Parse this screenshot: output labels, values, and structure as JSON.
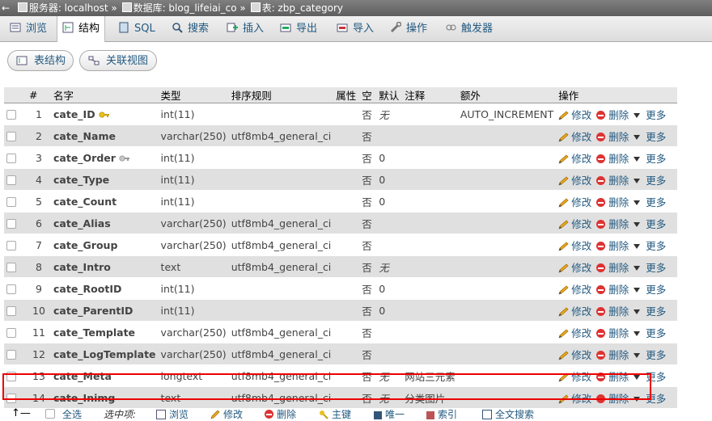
{
  "breadcrumb": {
    "server_label": "服务器: localhost",
    "db_label": "数据库: blog_lifeiai_co",
    "table_label": "表: zbp_category"
  },
  "tabs": [
    {
      "label": "浏览",
      "icon": "browse-icon"
    },
    {
      "label": "结构",
      "icon": "structure-icon",
      "active": true
    },
    {
      "label": "SQL",
      "icon": "sql-icon"
    },
    {
      "label": "搜索",
      "icon": "search-icon"
    },
    {
      "label": "插入",
      "icon": "insert-icon"
    },
    {
      "label": "导出",
      "icon": "export-icon"
    },
    {
      "label": "导入",
      "icon": "import-icon"
    },
    {
      "label": "操作",
      "icon": "wrench-icon"
    },
    {
      "label": "触发器",
      "icon": "trigger-icon"
    }
  ],
  "subtabs": {
    "table_structure": "表结构",
    "relation_view": "关联视图"
  },
  "columns": [
    "#",
    "名字",
    "类型",
    "排序规则",
    "属性",
    "空",
    "默认",
    "注释",
    "额外",
    "操作"
  ],
  "actions": {
    "edit": "修改",
    "drop": "删除",
    "more": "更多"
  },
  "rows": [
    {
      "num": "1",
      "name": "cate_ID",
      "key": "primary",
      "type": "int(11)",
      "collation": "",
      "null": "否",
      "default": "无",
      "comment": "",
      "extra": "AUTO_INCREMENT"
    },
    {
      "num": "2",
      "name": "cate_Name",
      "type": "varchar(250)",
      "collation": "utf8mb4_general_ci",
      "null": "否",
      "default": "",
      "comment": "",
      "extra": ""
    },
    {
      "num": "3",
      "name": "cate_Order",
      "key": "index",
      "type": "int(11)",
      "collation": "",
      "null": "否",
      "default": "0",
      "comment": "",
      "extra": ""
    },
    {
      "num": "4",
      "name": "cate_Type",
      "type": "int(11)",
      "collation": "",
      "null": "否",
      "default": "0",
      "comment": "",
      "extra": ""
    },
    {
      "num": "5",
      "name": "cate_Count",
      "type": "int(11)",
      "collation": "",
      "null": "否",
      "default": "0",
      "comment": "",
      "extra": ""
    },
    {
      "num": "6",
      "name": "cate_Alias",
      "type": "varchar(250)",
      "collation": "utf8mb4_general_ci",
      "null": "否",
      "default": "",
      "comment": "",
      "extra": ""
    },
    {
      "num": "7",
      "name": "cate_Group",
      "type": "varchar(250)",
      "collation": "utf8mb4_general_ci",
      "null": "否",
      "default": "",
      "comment": "",
      "extra": ""
    },
    {
      "num": "8",
      "name": "cate_Intro",
      "type": "text",
      "collation": "utf8mb4_general_ci",
      "null": "否",
      "default": "无",
      "comment": "",
      "extra": ""
    },
    {
      "num": "9",
      "name": "cate_RootID",
      "type": "int(11)",
      "collation": "",
      "null": "否",
      "default": "0",
      "comment": "",
      "extra": ""
    },
    {
      "num": "10",
      "name": "cate_ParentID",
      "type": "int(11)",
      "collation": "",
      "null": "否",
      "default": "0",
      "comment": "",
      "extra": ""
    },
    {
      "num": "11",
      "name": "cate_Template",
      "type": "varchar(250)",
      "collation": "utf8mb4_general_ci",
      "null": "否",
      "default": "",
      "comment": "",
      "extra": ""
    },
    {
      "num": "12",
      "name": "cate_LogTemplate",
      "type": "varchar(250)",
      "collation": "utf8mb4_general_ci",
      "null": "否",
      "default": "",
      "comment": "",
      "extra": ""
    },
    {
      "num": "13",
      "name": "cate_Meta",
      "type": "longtext",
      "collation": "utf8mb4_general_ci",
      "null": "否",
      "default": "无",
      "comment": "网站三元素",
      "extra": ""
    },
    {
      "num": "14",
      "name": "cate_Inimg",
      "type": "text",
      "collation": "utf8mb4_general_ci",
      "null": "否",
      "default": "无",
      "comment": "分类图片",
      "extra": "",
      "highlighted": true
    }
  ],
  "bottom": {
    "select_all": "全选",
    "with_selected": "选中项:",
    "browse": "浏览",
    "edit": "修改",
    "drop": "删除",
    "primary": "主键",
    "unique": "唯一",
    "index": "索引",
    "fulltext": "全文搜索"
  },
  "colors": {
    "link": "#235a81",
    "highlight_border": "#e00000",
    "drop_icon": "#dd3333",
    "row_alt": "#e0e0e0"
  }
}
